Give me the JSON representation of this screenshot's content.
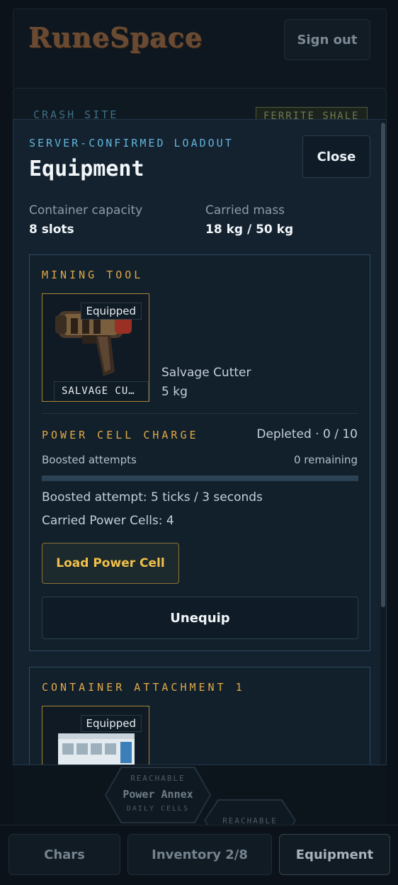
{
  "app": {
    "logo_text": "RuneSpace",
    "signout_label": "Sign out"
  },
  "background": {
    "location_label": "CRASH SITE",
    "resource_tag": "FERRITE SHALE",
    "map": {
      "node1": {
        "status": "REACHABLE",
        "name": "Power Annex",
        "subtitle": "DAILY CELLS"
      },
      "node2": {
        "status": "REACHABLE"
      }
    }
  },
  "bottom_nav": [
    {
      "label": "Chars"
    },
    {
      "label": "Inventory 2/8"
    },
    {
      "label": "Equipment"
    }
  ],
  "modal": {
    "eyebrow": "SERVER-CONFIRMED LOADOUT",
    "title": "Equipment",
    "close_label": "Close",
    "stats": {
      "capacity_label": "Container capacity",
      "capacity_value": "8 slots",
      "mass_label": "Carried mass",
      "mass_value": "18 kg / 50 kg"
    },
    "mining_tool": {
      "slot_title": "MINING TOOL",
      "badge": "Equipped",
      "item_short_name": "SALVAGE CU…",
      "item_name": "Salvage Cutter",
      "item_weight": "5 kg",
      "charge_title": "POWER CELL CHARGE",
      "charge_status": "Depleted · 0 / 10",
      "charge_fraction": 0,
      "boosted_label": "Boosted attempts",
      "boosted_remaining": "0 remaining",
      "boosted_attempt": "Boosted attempt: 5 ticks / 3 seconds",
      "carried_cells": "Carried Power Cells: 4",
      "load_label": "Load Power Cell",
      "unequip_label": "Unequip"
    },
    "container_attachment": {
      "slot_title": "CONTAINER ATTACHMENT 1",
      "badge": "Equipped"
    }
  },
  "colors": {
    "accent_cyan": "#62b3d8",
    "accent_gold": "#e0a847",
    "button_gold": "#f0c04a",
    "background": "#0b1219"
  }
}
